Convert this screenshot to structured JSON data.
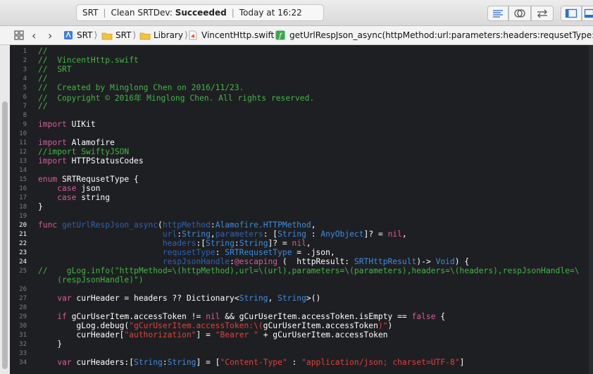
{
  "toolbar": {
    "scheme": "SRT",
    "status_action": "Clean SRTDev:",
    "status_result": "Succeeded",
    "status_time": "Today at 16:22"
  },
  "jumpbar": {
    "crumbs": [
      {
        "label": "SRT",
        "icon": "project-icon"
      },
      {
        "label": "SRT",
        "icon": "folder-icon"
      },
      {
        "label": "Library",
        "icon": "folder-icon"
      },
      {
        "label": "VincentHttp.swift",
        "icon": "swift-file-icon"
      },
      {
        "label": "getUrlRespJson_async(httpMethod:url:parameters:headers:requsetType:respJsonH",
        "icon": "function-icon"
      }
    ]
  },
  "editor": {
    "line_numbers": [
      "1",
      "2",
      "3",
      "4",
      "5",
      "6",
      "7",
      "8",
      "9",
      "10",
      "11",
      "12",
      "13",
      "14",
      "15",
      "16",
      "17",
      "18",
      "19",
      "20",
      "21",
      "22",
      "23",
      "24",
      "25",
      "26",
      "27",
      "28",
      "29",
      "30",
      "31",
      "32",
      "33",
      "34"
    ],
    "lines": {
      "l1": "//",
      "l2": "//  VincentHttp.swift",
      "l3": "//  SRT",
      "l4": "//",
      "l5": "//  Created by Minglong Chen on 2016/11/23.",
      "l6": "//  Copyright © 2016年 Minglong Chen. All rights reserved.",
      "l7": "//",
      "l9_kw": "import",
      "l9_rest": " UIKit",
      "l11_kw": "import",
      "l11_rest": " Alamofire",
      "l12": "//import SwiftyJSON",
      "l13_kw": "import",
      "l13_rest": " HTTPStatusCodes",
      "l15_kw": "enum",
      "l15_rest": " SRTRequsetType {",
      "l16_kw": "    case",
      "l16_rest": " json",
      "l17_kw": "    case",
      "l17_rest": " string",
      "l18": "}",
      "l20_kw": "func",
      "l20_name": " getUrlRespJson_async",
      "l20_a": "(",
      "l20_p": "httpMethod",
      "l20_b": ":",
      "l20_t": "Alamofire.HTTPMethod",
      "l20_c": ",",
      "l21_pad": "                          ",
      "l21_p1": "url",
      "l21_a": ":",
      "l21_t1": "String",
      "l21_b": ",",
      "l21_p2": "parameters",
      "l21_c": ": [",
      "l21_t2": "String",
      "l21_d": " : ",
      "l21_t3": "AnyObject",
      "l21_e": "]? = ",
      "l21_nil": "nil",
      "l21_f": ",",
      "l22_pad": "                          ",
      "l22_p": "headers",
      "l22_a": ":[",
      "l22_t1": "String",
      "l22_b": ":",
      "l22_t2": "String",
      "l22_c": "]? = ",
      "l22_nil": "nil",
      "l22_d": ",",
      "l23_pad": "                          ",
      "l23_p": "requsetType",
      "l23_a": ": ",
      "l23_t": "SRTRequsetType",
      "l23_b": " = .json,",
      "l24_pad": "                          ",
      "l24_p": "respJsonHandle",
      "l24_a": ":",
      "l24_k": "@escaping",
      "l24_b": " (  httpResult: ",
      "l24_t": "SRTHttpResult",
      "l24_c": ")-> ",
      "l24_t2": "Void",
      "l24_d": ") {",
      "l25a": "//    gLog.info(\"httpMethod=\\(httpMethod),url=\\(url),parameters=\\(parameters),headers=\\(headers),respJsonHandle=\\",
      "l25b": "    (respJsonHandle)\")",
      "l26_kw": "    var",
      "l26_a": " curHeader = headers ?? Dictionary<",
      "l26_t1": "String",
      "l26_b": ", ",
      "l26_t2": "String",
      "l26_c": ">()",
      "l28_kw": "    if",
      "l28_a": " gCurUserItem.accessToken != ",
      "l28_nil": "nil",
      "l28_b": " && gCurUserItem.accessToken.isEmpty == ",
      "l28_false": "false",
      "l28_c": " {",
      "l29_a": "        gLog.debug(",
      "l29_s": "\"gCurUserItem.accessToken:\\(",
      "l29_b": "gCurUserItem.accessToken",
      "l29_s2": ")\"",
      "l29_c": ")",
      "l30_a": "        curHeader[",
      "l30_s": "\"authorization\"",
      "l30_b": "] = ",
      "l30_s2": "\"Bearer \"",
      "l30_c": " + gCurUserItem.accessToken",
      "l31": "    }",
      "l33_kw": "    var",
      "l33_a": " curHeaders:[",
      "l33_t1": "String",
      "l33_b": ":",
      "l33_t2": "String",
      "l33_c": "] = [",
      "l33_s": "\"Content-Type\"",
      "l33_d": " : ",
      "l33_s2": "\"application/json; charset=UTF-8\"",
      "l33_e": "]"
    }
  },
  "colors": {
    "comment": "#41b645",
    "keyword": "#d35d9b",
    "string": "#e2413c",
    "type": "#3d8de0",
    "background": "#1e1f22"
  }
}
